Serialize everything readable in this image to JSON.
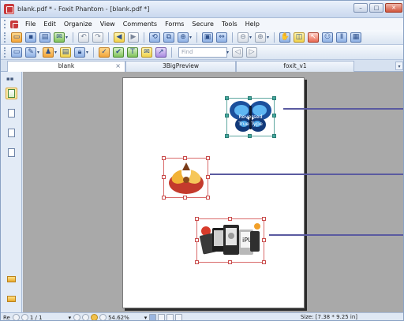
{
  "window": {
    "title": "blank.pdf * - Foxit Phantom - [blank.pdf *]",
    "controls": {
      "minimize": "–",
      "maximize": "□",
      "close": "✕"
    }
  },
  "menu": {
    "items": [
      "File",
      "Edit",
      "Organize",
      "View",
      "Comments",
      "Forms",
      "Secure",
      "Tools",
      "Help"
    ]
  },
  "toolbar2": {
    "find_placeholder": "Find"
  },
  "tabs": [
    {
      "label": "blank",
      "active": true,
      "close": "×"
    },
    {
      "label": "3BigPreview",
      "active": false
    },
    {
      "label": "foxit_v1",
      "active": false
    }
  ],
  "tab_scroll_icon": "chevron-down-icon",
  "document": {
    "page_bg": "#ffffff",
    "workspace_bg": "#a9a9a9",
    "annotations": [
      {
        "name": "butterfly-image",
        "caption_lines": [
          "Reversed",
          "True Type"
        ],
        "selection_color": "#44a89e"
      },
      {
        "name": "flower-image",
        "selection_color": "#d96a6a"
      },
      {
        "name": "ereaders-image",
        "device_label": "iPU",
        "selection_color": "#d96a6a"
      }
    ]
  },
  "statusbar": {
    "mode_label": "Re",
    "page_indicator": "1 / 1",
    "zoom": "54.62%",
    "page_size": "Size: [7.38 * 9.25 in]"
  },
  "colors": {
    "accent": "#dfe8f4",
    "line": "#5a5aa0",
    "selection": "#d96a6a"
  }
}
